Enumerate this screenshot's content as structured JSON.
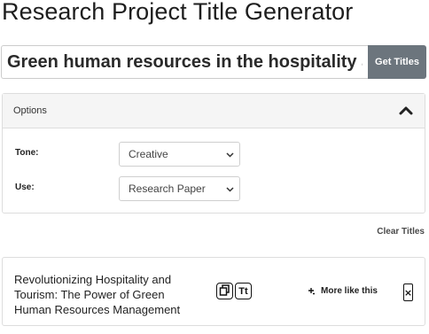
{
  "app": {
    "title": "Research Project Title Generator"
  },
  "search": {
    "value": "Green human resources in the hospitality and tourism industry",
    "button_label": "Get Titles"
  },
  "options": {
    "header": "Options",
    "tone": {
      "label": "Tone:",
      "value": "Creative"
    },
    "use": {
      "label": "Use:",
      "value": "Research Paper"
    }
  },
  "actions": {
    "clear_label": "Clear Titles"
  },
  "results": [
    {
      "title": "Revolutionizing Hospitality and Tourism: The Power of Green Human Resources Management",
      "case_label": "Tt",
      "more_label": "More like this",
      "close_label": "×"
    }
  ],
  "icons": {
    "collapse": "chevron-up-icon",
    "copy": "copy-icon",
    "case": "text-case-icon",
    "more": "sparkle-icon",
    "close": "close-icon",
    "select": "chevron-down-icon"
  }
}
